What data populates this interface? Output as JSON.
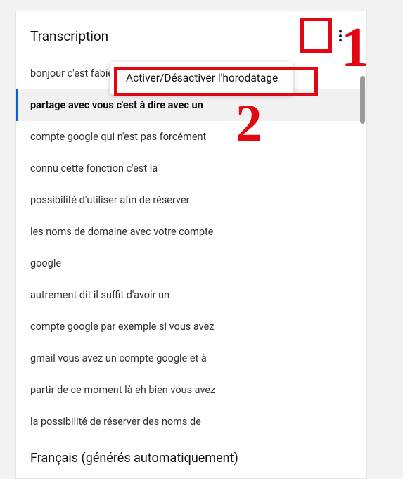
{
  "header": {
    "title": "Transcription"
  },
  "menu": {
    "toggle_timestamps": "Activer/Désactiver l'horodatage"
  },
  "transcript": {
    "active_index": 1,
    "lines": [
      "bonjour c'est fabien de web and seo et",
      "partage avec vous c'est à dire avec un",
      "compte google qui n'est pas forcément",
      "connu cette fonction c'est la",
      "possibilité d'utiliser afin de réserver",
      "les noms de domaine avec votre compte",
      "google",
      "autrement dit il suffit d'avoir un",
      "compte google par exemple si vous avez",
      "gmail vous avez un compte google et à",
      "partir de ce moment là eh bien vous avez",
      "la possibilité de réserver des noms de"
    ]
  },
  "footer": {
    "language": "Français (générés automatiquement)"
  },
  "annotations": {
    "n1": "1",
    "n2": "2"
  },
  "icons": {
    "more": "more-vert-icon"
  }
}
